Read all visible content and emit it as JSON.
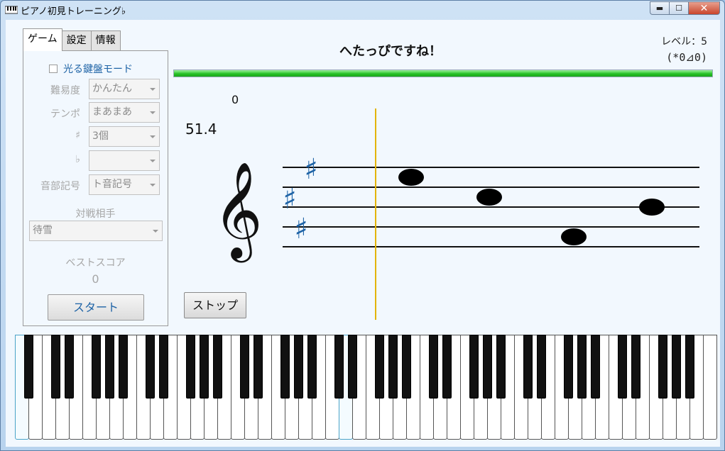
{
  "window": {
    "title": "ピアノ初見トレーニング♭",
    "min_label": "▬",
    "max_label": "☐",
    "close_label": "✕"
  },
  "tabs": [
    {
      "label": "ゲーム",
      "active": true
    },
    {
      "label": "設定",
      "active": false
    },
    {
      "label": "情報",
      "active": false
    }
  ],
  "panel": {
    "glow_mode_label": "光る鍵盤モード",
    "fields": [
      {
        "label": "難易度",
        "value": "かんたん"
      },
      {
        "label": "テンポ",
        "value": "まあまあ"
      },
      {
        "label": "♯",
        "value": "3個"
      },
      {
        "label": "♭",
        "value": ""
      },
      {
        "label": "音部記号",
        "value": "ト音記号"
      }
    ],
    "opponent_label": "対戦相手",
    "opponent_value": "待雪",
    "best_score_label": "ベストスコア",
    "best_score_value": "0",
    "start_label": "スタート"
  },
  "game": {
    "message": "へたっぴですね！",
    "level_text": "レベル：5",
    "face_text": "(*0⊿0)",
    "progress": 1.0,
    "score": "0",
    "timer": "51.4",
    "stop_label": "ストップ"
  },
  "staff": {
    "clef": "treble",
    "sharps": [
      "♯",
      "♯",
      "♯"
    ],
    "notes": [
      {
        "staff_step": 7
      },
      {
        "staff_step": 5
      },
      {
        "staff_step": 1
      },
      {
        "staff_step": 4
      }
    ]
  },
  "keyboard": {
    "white_key_count": 52,
    "highlighted_white_keys": [
      0,
      24
    ]
  },
  "colors": {
    "accent_text": "#1e63a6",
    "progress_green": "#27c227",
    "playhead": "#e3b400",
    "sharp_color": "#1e63a6"
  }
}
